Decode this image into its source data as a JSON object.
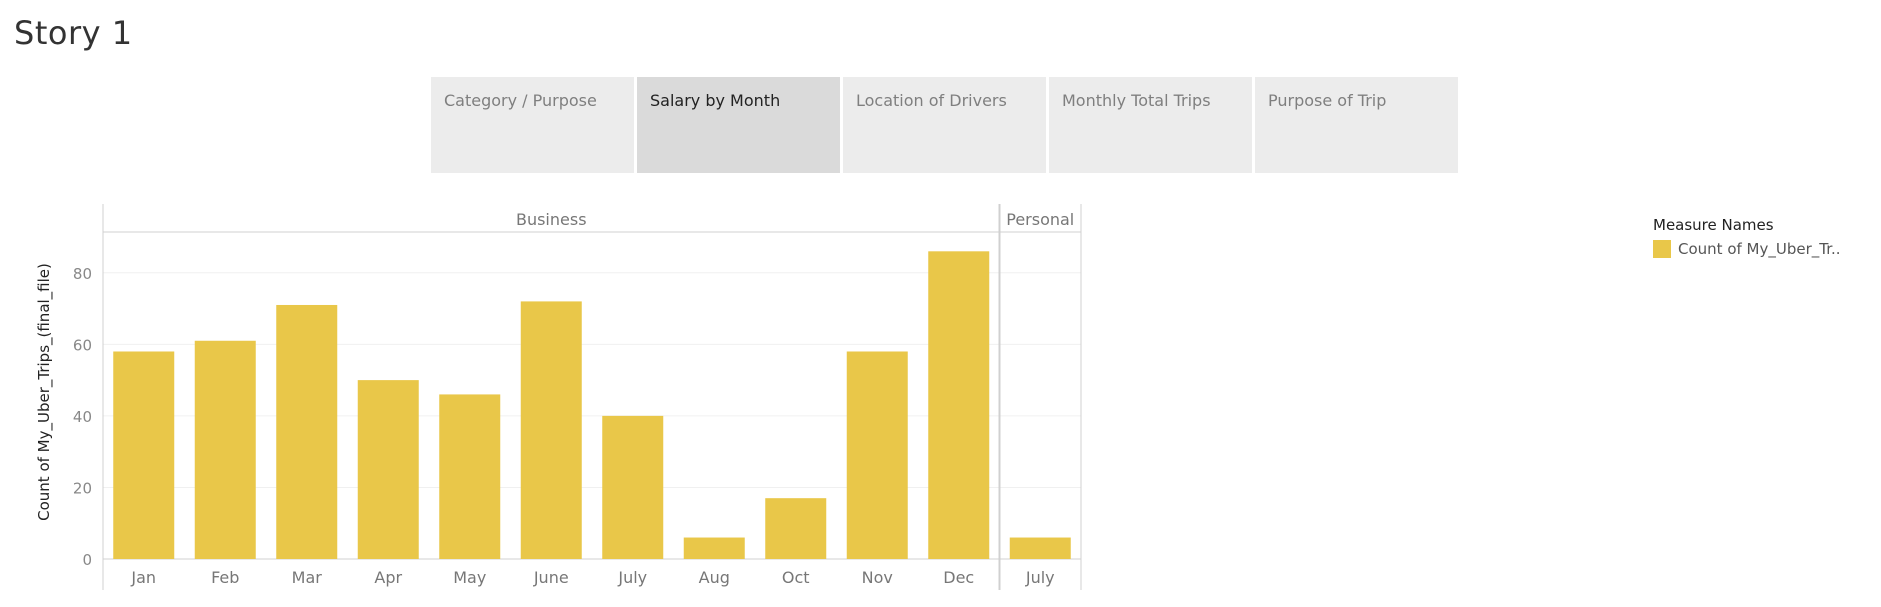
{
  "story": {
    "title": "Story 1"
  },
  "nav": {
    "tabs": [
      {
        "label": "Category / Purpose",
        "active": false
      },
      {
        "label": "Salary by Month",
        "active": true
      },
      {
        "label": "Location of Drivers",
        "active": false
      },
      {
        "label": "Monthly Total Trips",
        "active": false
      },
      {
        "label": "Purpose of Trip",
        "active": false
      }
    ]
  },
  "legend": {
    "title": "Measure Names",
    "items": [
      {
        "label": "Count of My_Uber_Tr..",
        "color": "#e9c749"
      }
    ]
  },
  "chart_data": {
    "type": "bar",
    "ylabel": "Count of My_Uber_Trips_(final_file)",
    "xlabel": "",
    "ylim": [
      0,
      90
    ],
    "yticks": [
      0,
      20,
      40,
      60,
      80
    ],
    "grid": true,
    "bar_color": "#e9c749",
    "panels": [
      {
        "name": "Business",
        "categories": [
          "Jan",
          "Feb",
          "Mar",
          "Apr",
          "May",
          "June",
          "July",
          "Aug",
          "Oct",
          "Nov",
          "Dec"
        ],
        "values": [
          58,
          61,
          71,
          50,
          46,
          72,
          40,
          6,
          17,
          58,
          86
        ]
      },
      {
        "name": "Personal",
        "categories": [
          "July"
        ],
        "values": [
          6
        ]
      }
    ]
  }
}
